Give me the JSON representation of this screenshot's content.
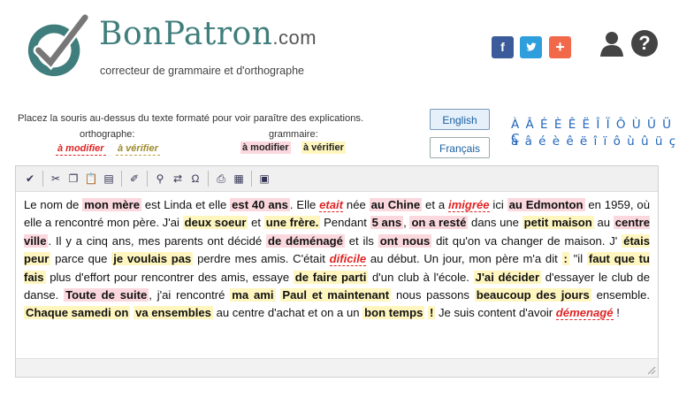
{
  "header": {
    "brand_main": "BonPatron",
    "brand_suffix": ".com",
    "tagline": "correcteur de grammaire et d'orthographe",
    "social": {
      "facebook": "f",
      "twitter": "t",
      "plus": "+"
    },
    "help": "?"
  },
  "legend": {
    "instruction": "Placez la souris au-dessus du texte formaté pour voir paraître des explications.",
    "orthographe_label": "orthographe:",
    "grammaire_label": "grammaire:",
    "ortho_modifier": "à modifier",
    "ortho_verifier": "à vérifier",
    "gram_modifier": "à modifier",
    "gram_verifier": "à vérifier"
  },
  "languages": {
    "english": "English",
    "francais": "Français"
  },
  "accents": {
    "upper": "À Â É È Ê Ë Î Ï Ô Ù Û Ü Ç",
    "lower": "à â é è ê ë î ï ô ù û ü ç"
  },
  "text": {
    "p01": "Le nom de ",
    "s01": "mon mère",
    "p02": " est Linda et elle ",
    "s02": "est 40 ans",
    "p03": ". Elle ",
    "s03": "etait",
    "p04": " née ",
    "s04": "au Chine",
    "p05": " et a ",
    "s05": "imigrée",
    "p06": " ici ",
    "s06": "au Edmonton",
    "p07": " en 1959, où elle a rencontré mon père. J'ai ",
    "s07": "deux soeur",
    "p08": " et ",
    "s08": "une frère.",
    "p09": " Pendant ",
    "s09": "5 ans",
    "p10": ", ",
    "s10": "on a resté",
    "p11": " dans une ",
    "s11": "petit maison",
    "p12": " au ",
    "s12": "centre ville",
    "p13": ". Il y a cinq ans, mes parents ont décidé ",
    "s13": "de déménagé",
    "p14": " et ils ",
    "s14": "ont nous",
    "p15": " dit qu'on va changer de maison. J' ",
    "s15": "étais peur",
    "p16": " parce que ",
    "s16": "je voulais pas",
    "p17": " perdre mes amis. C'était ",
    "s17": "dificile",
    "p18": " au début. Un jour, mon père m'a dit ",
    "s18": ":",
    "p19": " \"il ",
    "s19": "faut que tu fais",
    "p20": " plus d'effort pour rencontrer des amis, essaye ",
    "s20": "de faire parti",
    "p21": " d'un club à l'école. ",
    "s21": "J'ai décider",
    "p22": " d'essayer le club de danse. ",
    "s22": "Toute de suite",
    "p23": ", j'ai rencontré ",
    "s23": "ma ami",
    "p24": " ",
    "s24": "Paul et maintenant",
    "p25": " nous passons ",
    "s25": "beaucoup des jours",
    "p26": " ensemble. ",
    "s26": "Chaque samedi on",
    "p27": " ",
    "s27": "va ensembles",
    "p28": " au centre d'achat et on a un ",
    "s28": "bon temps",
    "p29": " ",
    "s29": "!",
    "p30": " Je suis content d'avoir ",
    "s30": "démenagé",
    "p31": " !"
  },
  "colors": {
    "brand": "#3f7e7c",
    "pink": "#fbd8de",
    "yellow": "#fff6bf",
    "error_red": "#e02424",
    "check_olive": "#9c8a2e"
  }
}
